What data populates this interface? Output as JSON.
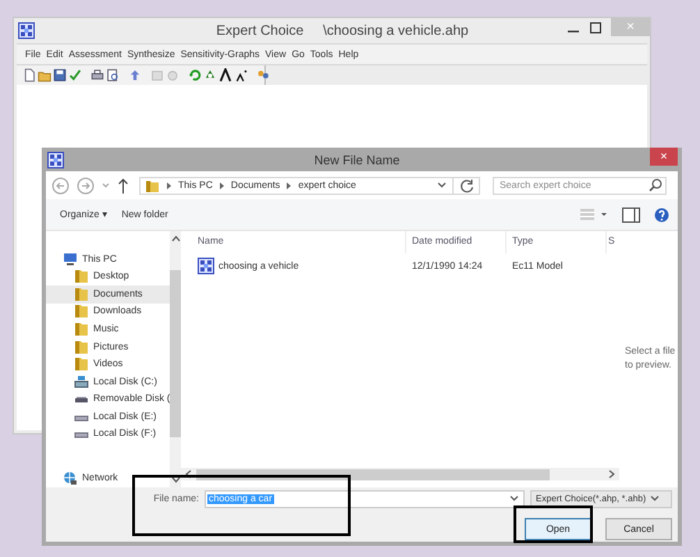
{
  "main_window": {
    "title": "Expert Choice     \\choosing a vehicle.ahp",
    "menu": [
      {
        "label": "File"
      },
      {
        "label": "Edit"
      },
      {
        "label": "Assessment"
      },
      {
        "label": "Synthesize"
      },
      {
        "label": "Sensitivity-Graphs"
      },
      {
        "label": "View"
      },
      {
        "label": "Go"
      },
      {
        "label": "Tools"
      },
      {
        "label": "Help"
      }
    ],
    "close": "×"
  },
  "dialog": {
    "title": "New File Name",
    "close": "×",
    "breadcrumb": [
      "This PC",
      "Documents",
      "expert choice"
    ],
    "search": {
      "placeholder": "Search expert choice"
    },
    "toolbar": [
      "Organize ▾",
      "New folder"
    ],
    "nav": [
      {
        "label": "This PC",
        "kind": "pc",
        "selected": false,
        "children": [
          {
            "label": "Desktop",
            "kind": "folder",
            "selected": false
          },
          {
            "label": "Documents",
            "kind": "folder",
            "selected": true
          },
          {
            "label": "Downloads",
            "kind": "folder",
            "selected": false
          },
          {
            "label": "Music",
            "kind": "folder",
            "selected": false
          },
          {
            "label": "Pictures",
            "kind": "folder",
            "selected": false
          },
          {
            "label": "Videos",
            "kind": "folder",
            "selected": false
          },
          {
            "label": "Local Disk (C:)",
            "kind": "system-disk",
            "selected": false
          },
          {
            "label": "Removable Disk (",
            "kind": "removable",
            "selected": false
          },
          {
            "label": "Local Disk (E:)",
            "kind": "disk",
            "selected": false
          },
          {
            "label": "Local Disk (F:)",
            "kind": "disk",
            "selected": false
          }
        ]
      },
      {
        "label": "Network",
        "kind": "network",
        "selected": false
      }
    ],
    "columns": [
      "Name",
      "Date modified",
      "Type",
      "S"
    ],
    "rows": [
      {
        "name": "choosing a vehicle",
        "date": "12/1/1990 14:24",
        "type": "Ec11 Model",
        "selected": false
      }
    ],
    "preview": "Select a file to preview.",
    "file_name": {
      "label": "File name:",
      "value": "choosing a car"
    },
    "file_type": "Expert Choice(*.ahp, *.ahb)",
    "buttons": [
      "Open",
      "Cancel"
    ]
  }
}
